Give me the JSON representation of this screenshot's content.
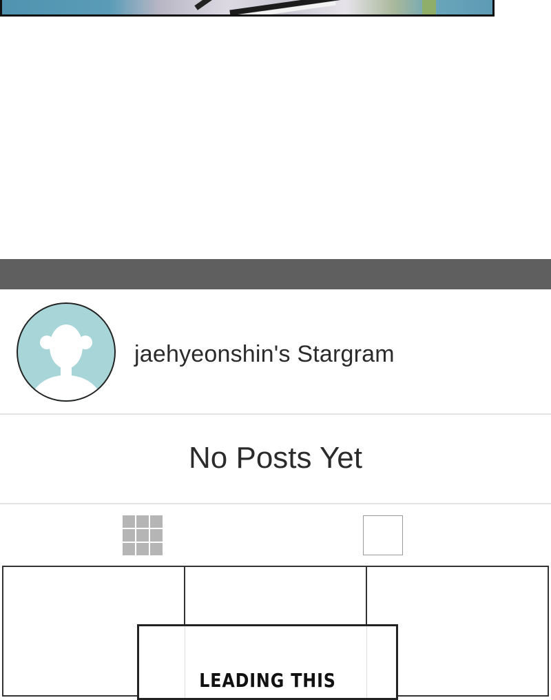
{
  "profile": {
    "username_title": "jaehyeonshin's Stargram"
  },
  "feed": {
    "empty_message": "No Posts Yet"
  },
  "tabs": [
    {
      "icon": "grid-view-icon",
      "active": true
    },
    {
      "icon": "single-view-icon",
      "active": false
    }
  ],
  "comic": {
    "caption": "LEADING THIS"
  },
  "colors": {
    "header_bar": "#5f5f5f",
    "avatar_bg": "#a8d6d8",
    "grid_icon": "#b5b5b5"
  }
}
